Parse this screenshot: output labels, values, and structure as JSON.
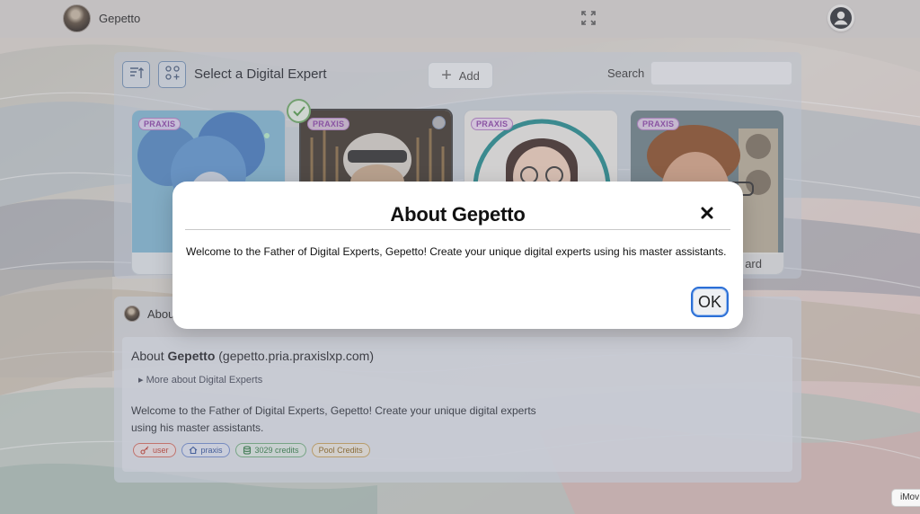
{
  "app": {
    "title": "Gepetto"
  },
  "picker": {
    "title": "Select a Digital Expert",
    "add_label": "Add",
    "search_label": "Search",
    "search_value": "",
    "cards": [
      {
        "badge": "PRAXIS",
        "label": ""
      },
      {
        "badge": "PRAXIS",
        "label": ""
      },
      {
        "badge": "PRAXIS",
        "label": ""
      },
      {
        "badge": "PRAXIS",
        "label": "ard"
      }
    ]
  },
  "about_panel": {
    "tab_label": "Abou",
    "heading_prefix": "About ",
    "heading_name": "Gepetto",
    "heading_suffix": " (gepetto.pria.praxislxp.com)",
    "more_label": "▸ More about Digital Experts",
    "description": "Welcome to the Father of Digital Experts, Gepetto! Create your unique digital experts using his master assistants.",
    "tags": {
      "user": "user",
      "praxis": "praxis",
      "credits": "3029 credits",
      "pool": "Pool Credits"
    }
  },
  "modal": {
    "title": "About Gepetto",
    "body": "Welcome to the Father of Digital Experts, Gepetto! Create your unique digital experts using his master assistants.",
    "ok_label": "OK",
    "close_glyph": "✕"
  },
  "corner_tip": {
    "text": "iMov"
  },
  "icons": {
    "expand": "expand-icon",
    "account": "account-circle-icon",
    "sort": "sort-icon",
    "grid_add": "grid-add-icon",
    "check": "check-icon",
    "info": "info-icon"
  }
}
